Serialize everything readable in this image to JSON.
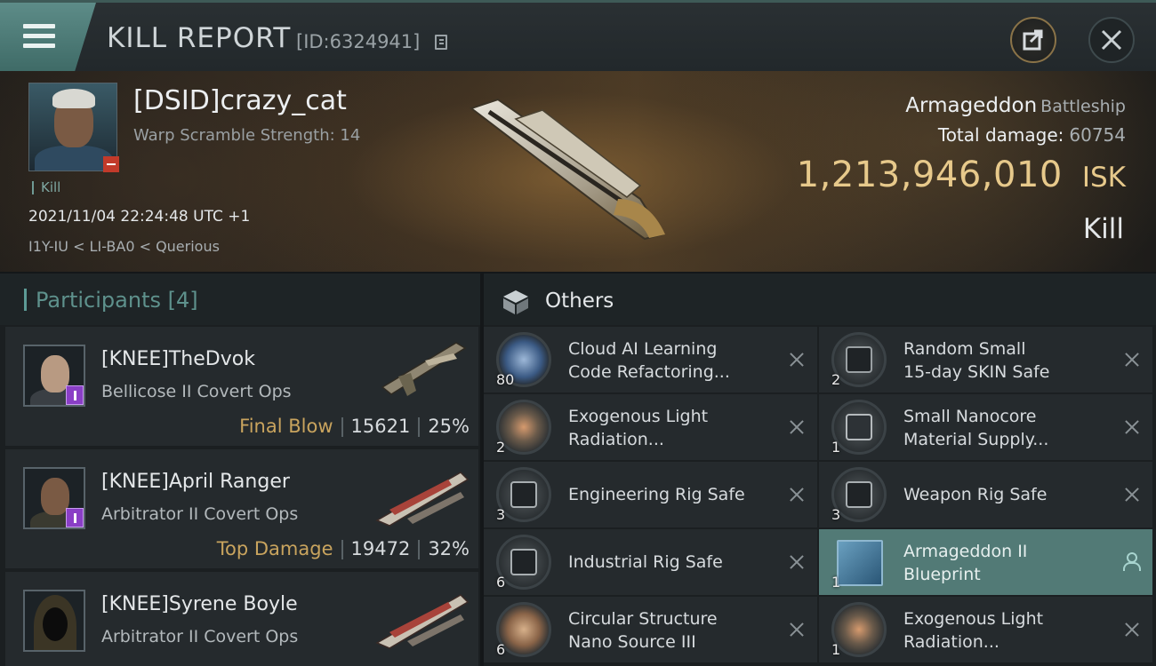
{
  "header": {
    "title": "KILL REPORT",
    "report_id": "[ID:6324941]"
  },
  "victim": {
    "name": "[DSID]crazy_cat",
    "warp_scramble": "Warp Scramble Strength: 14",
    "kill_tag": "Kill",
    "timestamp": "2021/11/04 22:24:48 UTC +1",
    "location": "I1Y-IU < LI-BA0 < Querious",
    "ship": "Armageddon",
    "ship_class": "Battleship",
    "total_damage_label": "Total damage:",
    "total_damage": "60754",
    "isk_value": "1,213,946,010",
    "isk_unit": "ISK",
    "result": "Kill"
  },
  "participants": {
    "label": "Participants",
    "count": "[4]",
    "rows": [
      {
        "name": "[KNEE]TheDvok",
        "ship": "Bellicose II Covert Ops",
        "tag": "Final Blow",
        "damage": "15621",
        "percent": "25%"
      },
      {
        "name": "[KNEE]April Ranger",
        "ship": "Arbitrator II Covert Ops",
        "tag": "Top Damage",
        "damage": "19472",
        "percent": "32%"
      },
      {
        "name": "[KNEE]Syrene Boyle",
        "ship": "Arbitrator II Covert Ops",
        "tag": "",
        "damage": "",
        "percent": ""
      }
    ]
  },
  "others": {
    "label": "Others",
    "items": [
      {
        "qty": "80",
        "name": "Cloud AI Learning Code Refactoring...",
        "line1": "Cloud AI Learning",
        "line2": "Code Refactoring..."
      },
      {
        "qty": "2",
        "name": "Random Small 15-day SKIN Safe",
        "line1": "Random Small",
        "line2": "15-day SKIN Safe"
      },
      {
        "qty": "2",
        "name": "Exogenous Light Radiation...",
        "line1": "Exogenous Light",
        "line2": "Radiation..."
      },
      {
        "qty": "1",
        "name": "Small Nanocore Material Supply...",
        "line1": "Small Nanocore",
        "line2": "Material Supply..."
      },
      {
        "qty": "3",
        "name": "Engineering Rig Safe",
        "line1": "Engineering Rig Safe",
        "line2": ""
      },
      {
        "qty": "3",
        "name": "Weapon Rig Safe",
        "line1": "Weapon Rig Safe",
        "line2": ""
      },
      {
        "qty": "6",
        "name": "Industrial Rig Safe",
        "line1": "Industrial Rig Safe",
        "line2": ""
      },
      {
        "qty": "1",
        "name": "Armageddon II Blueprint",
        "line1": "Armageddon II",
        "line2": "Blueprint"
      },
      {
        "qty": "6",
        "name": "Circular Structure Nano Source III",
        "line1": "Circular Structure",
        "line2": "Nano Source III"
      },
      {
        "qty": "1",
        "name": "Exogenous Light Radiation...",
        "line1": "Exogenous Light",
        "line2": "Radiation..."
      }
    ]
  },
  "colors": {
    "accent_teal": "#5e918c",
    "isk_gold": "#e7c98b",
    "tag_gold": "#c9a45e",
    "selected_row": "#527a76"
  },
  "icons": [
    "menu-icon",
    "copy-icon",
    "share-icon",
    "close-icon",
    "box-icon",
    "remove-icon",
    "user-icon"
  ]
}
